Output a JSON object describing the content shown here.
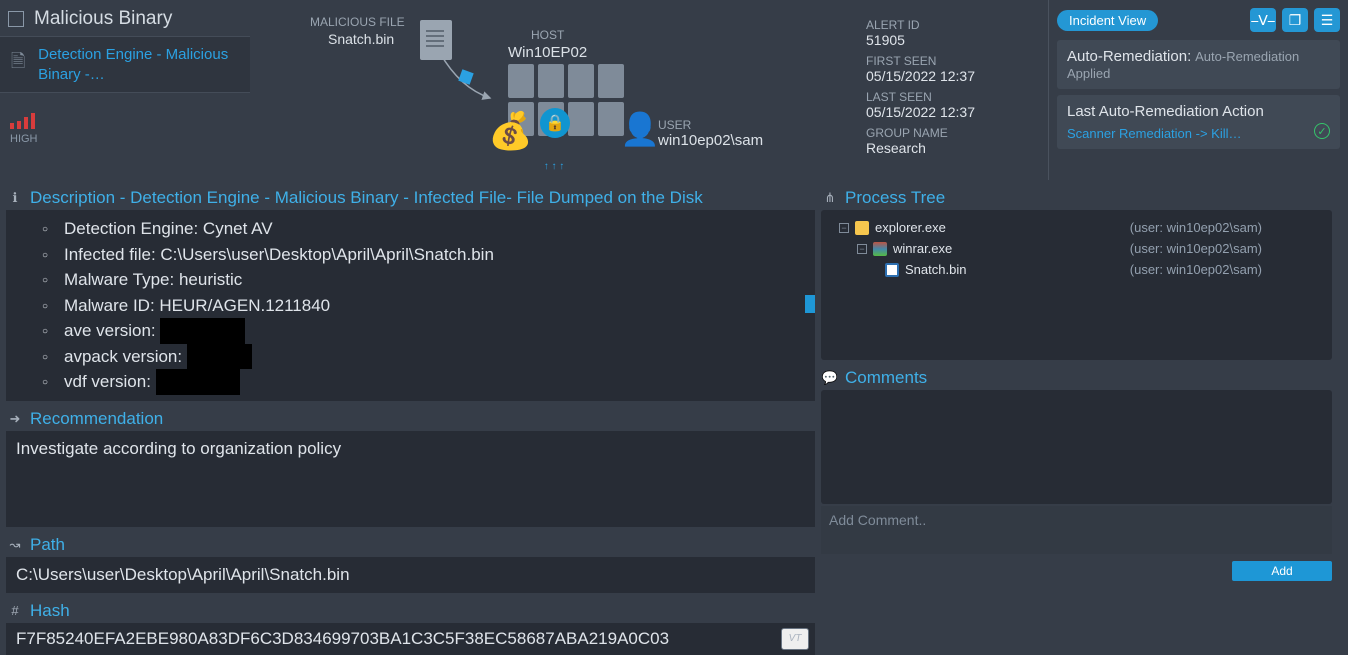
{
  "sidebar": {
    "title": "Malicious Binary",
    "detection_link": "Detection Engine - Malicious Binary -…",
    "severity": "HIGH"
  },
  "graph": {
    "malicious_file_label": "MALICIOUS FILE",
    "malicious_file_name": "Snatch.bin",
    "host_label": "HOST",
    "host_name": "Win10EP02",
    "user_label": "USER",
    "user_name": "win10ep02\\sam"
  },
  "meta": {
    "alert_id_label": "ALERT ID",
    "alert_id": "51905",
    "first_seen_label": "FIRST SEEN",
    "first_seen": "05/15/2022 12:37",
    "last_seen_label": "LAST SEEN",
    "last_seen": "05/15/2022 12:37",
    "group_label": "GROUP NAME",
    "group": "Research"
  },
  "actions": {
    "incident_view": "Incident View",
    "auto_remediation_label": "Auto-Remediation:",
    "auto_remediation_status": "Auto-Remediation Applied",
    "last_action_label": "Last Auto-Remediation Action",
    "last_action_link": "Scanner Remediation -> Kill…"
  },
  "description": {
    "title": "Description - Detection Engine - Malicious Binary - Infected File- File Dumped on the Disk",
    "items": [
      "Detection Engine: Cynet AV",
      "Infected file: C:\\Users\\user\\Desktop\\April\\April\\Snatch.bin",
      "Malware Type: heuristic",
      "Malware ID: HEUR/AGEN.1211840"
    ],
    "ave_label": "ave version: ",
    "avpack_label": "avpack version: ",
    "vdf_label": "vdf version: "
  },
  "recommendation": {
    "title": "Recommendation",
    "text": "Investigate according to organization policy"
  },
  "path": {
    "title": "Path",
    "value": "C:\\Users\\user\\Desktop\\April\\April\\Snatch.bin"
  },
  "hash": {
    "title": "Hash",
    "value": "F7F85240EFA2EBE980A83DF6C3D834699703BA1C3C5F38EC58687ABA219A0C03",
    "vt_label": "VT"
  },
  "process_tree": {
    "title": "Process Tree",
    "rows": [
      {
        "name": "explorer.exe",
        "user": "(user: win10ep02\\sam)"
      },
      {
        "name": "winrar.exe",
        "user": "(user: win10ep02\\sam)"
      },
      {
        "name": "Snatch.bin",
        "user": "(user: win10ep02\\sam)"
      }
    ]
  },
  "comments": {
    "title": "Comments",
    "placeholder": "Add Comment..",
    "add_label": "Add"
  }
}
